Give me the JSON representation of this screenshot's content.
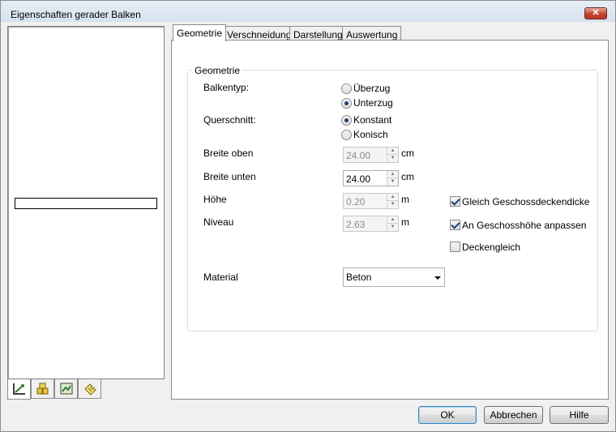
{
  "window": {
    "title": "Eigenschaften gerader Balken",
    "close_label": "✕"
  },
  "left_tabs": [
    {
      "icon": "dimension-tool-icon"
    },
    {
      "icon": "building-blocks-icon"
    },
    {
      "icon": "layer-image-icon"
    },
    {
      "icon": "note-pad-icon"
    }
  ],
  "tabs": [
    "Geometrie",
    "Verschneidung",
    "Darstellung",
    "Auswertung"
  ],
  "active_tab": "Geometrie",
  "group": {
    "legend": "Geometrie",
    "balkentyp": {
      "label": "Balkentyp:",
      "options": [
        "Überzug",
        "Unterzug"
      ],
      "selected": "Unterzug"
    },
    "querschnitt": {
      "label": "Querschnitt:",
      "options": [
        "Konstant",
        "Konisch"
      ],
      "selected": "Konstant"
    },
    "breite_oben": {
      "label": "Breite oben",
      "value": "24.00",
      "unit": "cm",
      "enabled": false
    },
    "breite_unten": {
      "label": "Breite unten",
      "value": "24.00",
      "unit": "cm",
      "enabled": true
    },
    "hoehe": {
      "label": "Höhe",
      "value": "0.20",
      "unit": "m",
      "enabled": false
    },
    "niveau": {
      "label": "Niveau",
      "value": "2.63",
      "unit": "m",
      "enabled": false
    },
    "checkboxes": [
      {
        "label": "Gleich Geschossdeckendicke",
        "checked": true
      },
      {
        "label": "An Geschosshöhe anpassen",
        "checked": true
      },
      {
        "label": "Deckengleich",
        "checked": false
      }
    ],
    "material": {
      "label": "Material",
      "value": "Beton"
    }
  },
  "buttons": {
    "ok": "OK",
    "cancel": "Abbrechen",
    "help": "Hilfe"
  }
}
